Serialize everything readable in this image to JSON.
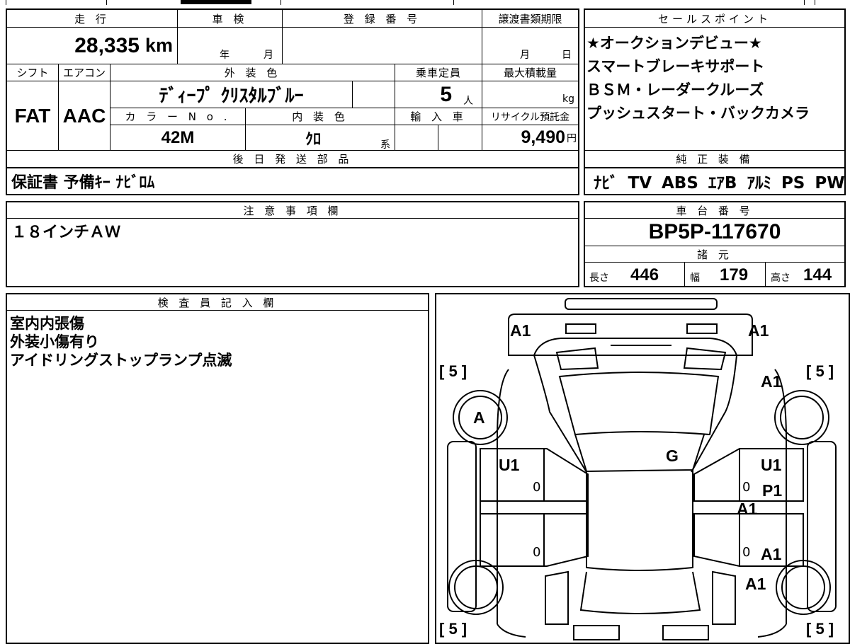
{
  "headers": {
    "mileage": "走 行",
    "inspection": "車 検",
    "registration": "登 録 番 号",
    "transfer_deadline": "譲渡書類期限",
    "sales_points": "セールスポイント",
    "shift": "シフト",
    "aircon": "エアコン",
    "exterior_color": "外 装 色",
    "capacity": "乗車定員",
    "max_load": "最大積載量",
    "color_no": "カ ラ ー N o .",
    "interior_color": "内 装 色",
    "import": "輸 入 車",
    "recycle_fee": "リサイクル預託金",
    "later_parts": "後 日 発 送 部 品",
    "genuine_equipment": "純 正 装 備",
    "notes": "注 意 事 項 欄",
    "chassis_number": "車 台 番 号",
    "specs": "諸 元",
    "inspector": "検 査 員 記 入 欄"
  },
  "values": {
    "mileage": "28,335",
    "mileage_unit": "km",
    "inspection_year": "年",
    "inspection_month": "月",
    "transfer_month": "月",
    "transfer_day": "日",
    "shift": "FAT",
    "aircon": "AAC",
    "exterior_color": "ﾃﾞｨｰﾌﾟ ｸﾘｽﾀﾙﾌﾞﾙｰ",
    "capacity": "5",
    "capacity_unit": "人",
    "max_load_unit": "kg",
    "color_no": "42M",
    "interior_color": "ｸﾛ",
    "interior_suffix": "系",
    "recycle_fee": "9,490",
    "recycle_unit": "円",
    "later_parts": "保証書 予備ｷｰ ﾅﾋﾞﾛﾑ",
    "genuine_equipment": "ﾅﾋﾞ TV ABS ｴｱB ｱﾙﾐ PS PW",
    "notes": "１８インチＡＷ",
    "chassis_number": "BP5P-117670",
    "length_label": "長さ",
    "length": "446",
    "width_label": "幅",
    "width": "179",
    "height_label": "高さ",
    "height": "144"
  },
  "sales_points": [
    "★オークションデビュー★",
    "スマートブレーキサポート",
    "ＢＳＭ・レーダークルーズ",
    "プッシュスタート・バックカメラ"
  ],
  "inspector_notes": [
    "室内内張傷",
    "外装小傷有り",
    "アイドリングストップランプ点滅"
  ],
  "diagram": {
    "tl_bracket": "[ 5 ]",
    "tr_bracket": "[ 5 ]",
    "bl_bracket": "[ 5 ]",
    "br_bracket": "[ 5 ]",
    "front_left": "A1",
    "front_right": "A1",
    "front_right_fender": "A1",
    "front_left_wheel": "A",
    "windshield": "G",
    "left_front_door": "U1",
    "right_front_door": "U1",
    "right_front_door_2": "P1",
    "right_pillar": "A1",
    "right_rear_door": "A1",
    "right_rear_fender": "A1",
    "zero_lf": "0",
    "zero_lr": "0",
    "zero_rf": "0",
    "zero_rr": "0"
  }
}
